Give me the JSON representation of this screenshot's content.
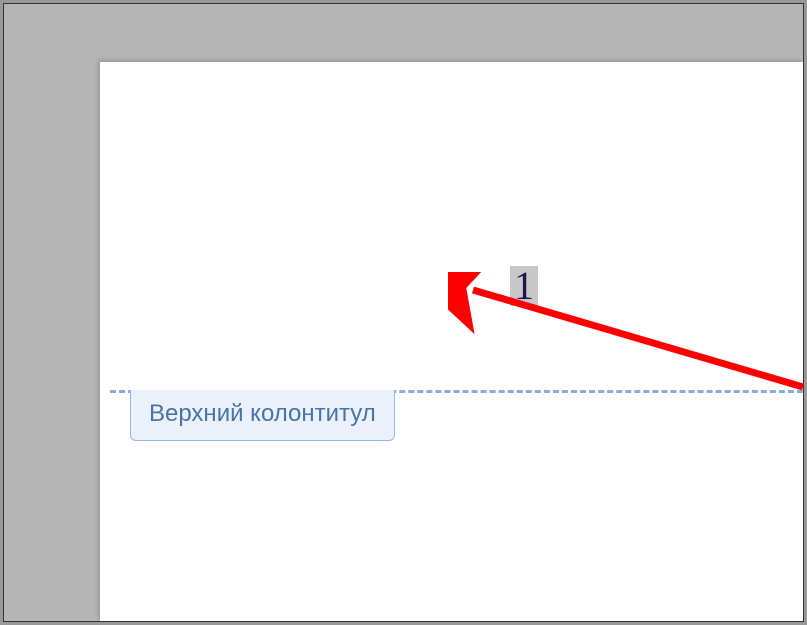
{
  "header": {
    "page_number": "1",
    "tab_label": "Верхний колонтитул"
  },
  "colors": {
    "accent": "#88aee0",
    "tab_bg": "#eaf1fa",
    "tab_border": "#96b9e2",
    "tab_text": "#4a74a8",
    "arrow": "#ff0000"
  }
}
